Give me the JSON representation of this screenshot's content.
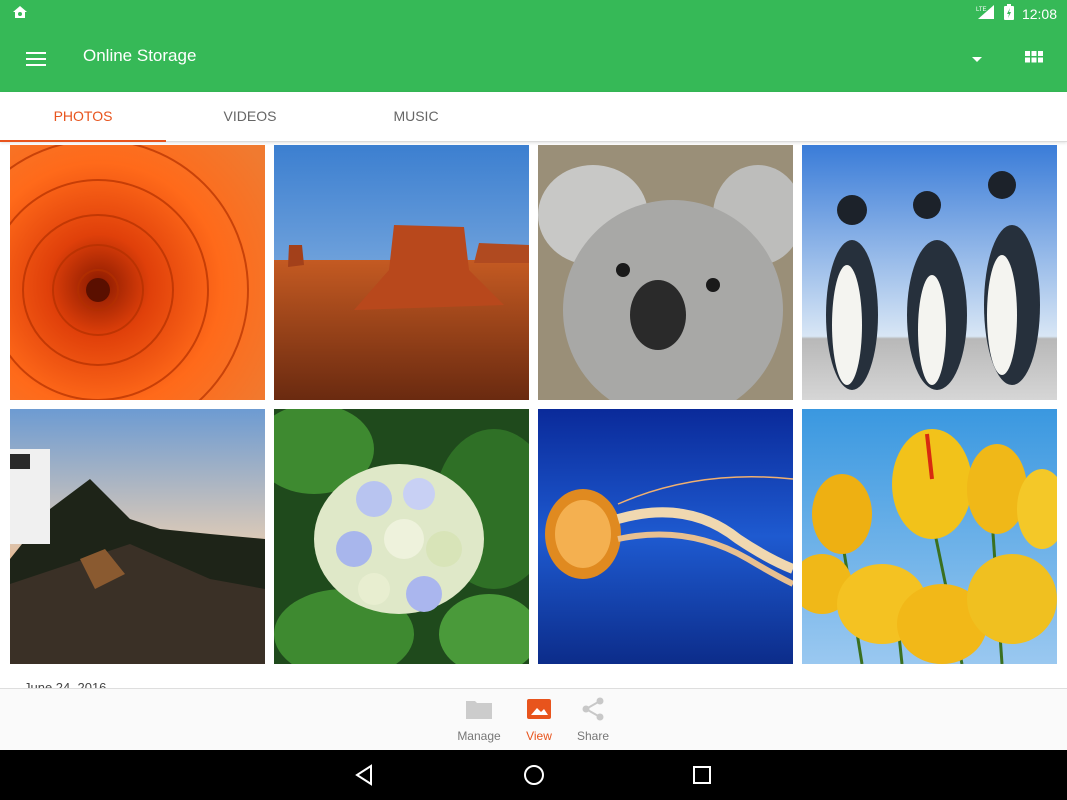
{
  "status_bar": {
    "time": "12:08",
    "network": "LTE"
  },
  "app_bar": {
    "title": "Online Storage"
  },
  "tabs": [
    {
      "label": "PHOTOS",
      "active": true
    },
    {
      "label": "VIDEOS",
      "active": false
    },
    {
      "label": "MUSIC",
      "active": false
    }
  ],
  "gallery": {
    "photos": [
      "chrysanthemum",
      "desert",
      "koala",
      "penguins",
      "lighthouse",
      "hydrangeas",
      "jellyfish",
      "tulips"
    ]
  },
  "date_label": "June 24, 2016",
  "bottom_nav": [
    {
      "label": "Manage",
      "icon": "folder-icon",
      "active": false
    },
    {
      "label": "View",
      "icon": "image-icon",
      "active": true
    },
    {
      "label": "Share",
      "icon": "share-icon",
      "active": false
    }
  ],
  "colors": {
    "app_bar": "#36b957",
    "accent": "#e8541d"
  }
}
